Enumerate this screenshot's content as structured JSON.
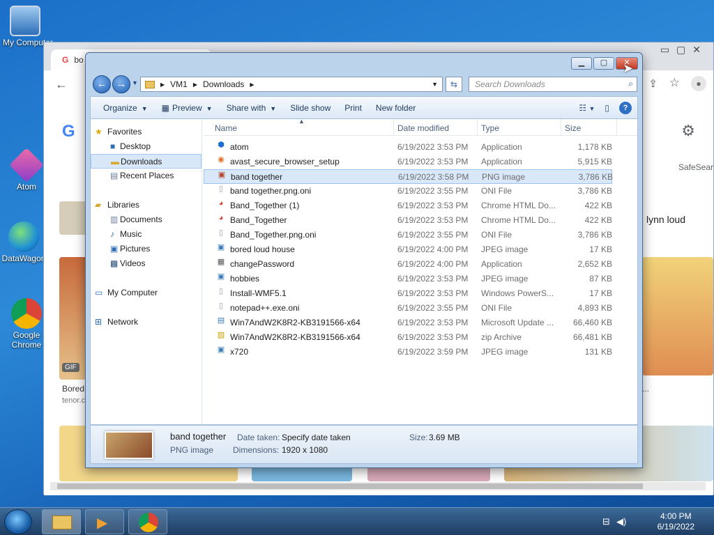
{
  "desktop": {
    "icons": [
      {
        "label": "My Computer",
        "icon": "computer-icon"
      },
      {
        "label": "Atom",
        "icon": "atom-icon"
      },
      {
        "label": "DataWagon",
        "icon": "globe-icon"
      },
      {
        "label": "Google Chrome",
        "icon": "chrome-icon"
      }
    ]
  },
  "chrome": {
    "tab_title": "bo",
    "lynn_text": "lynn loud",
    "safesearch": "SafeSear",
    "gif_badge": "GIF",
    "bored_caption": "Bored",
    "tenor": "tenor.c",
    "ellipsis": "..."
  },
  "explorer": {
    "breadcrumb": [
      "VM1",
      "Downloads"
    ],
    "search_placeholder": "Search Downloads",
    "toolbar": {
      "organize": "Organize",
      "preview": "Preview",
      "share_with": "Share with",
      "slide_show": "Slide show",
      "print": "Print",
      "new_folder": "New folder"
    },
    "nav": {
      "favorites": "Favorites",
      "desktop": "Desktop",
      "downloads": "Downloads",
      "recent_places": "Recent Places",
      "libraries": "Libraries",
      "documents": "Documents",
      "music": "Music",
      "pictures": "Pictures",
      "videos": "Videos",
      "my_computer": "My Computer",
      "network": "Network"
    },
    "columns": {
      "name": "Name",
      "date": "Date modified",
      "type": "Type",
      "size": "Size"
    },
    "files": [
      {
        "name": "atom",
        "date": "6/19/2022 3:53 PM",
        "type": "Application",
        "size": "1,178 KB",
        "icon": "atom-app-icon"
      },
      {
        "name": "avast_secure_browser_setup",
        "date": "6/19/2022 3:53 PM",
        "type": "Application",
        "size": "5,915 KB",
        "icon": "avast-app-icon"
      },
      {
        "name": "band together",
        "date": "6/19/2022 3:58 PM",
        "type": "PNG image",
        "size": "3,786 KB",
        "icon": "png-image-icon"
      },
      {
        "name": "band together.png.oni",
        "date": "6/19/2022 3:55 PM",
        "type": "ONI File",
        "size": "3,786 KB",
        "icon": "blank-file-icon"
      },
      {
        "name": "Band_Together (1)",
        "date": "6/19/2022 3:53 PM",
        "type": "Chrome HTML Do...",
        "size": "422 KB",
        "icon": "chrome-html-icon"
      },
      {
        "name": "Band_Together",
        "date": "6/19/2022 3:53 PM",
        "type": "Chrome HTML Do...",
        "size": "422 KB",
        "icon": "chrome-html-icon"
      },
      {
        "name": "Band_Together.png.oni",
        "date": "6/19/2022 3:55 PM",
        "type": "ONI File",
        "size": "3,786 KB",
        "icon": "blank-file-icon"
      },
      {
        "name": "bored loud house",
        "date": "6/19/2022 4:00 PM",
        "type": "JPEG image",
        "size": "17 KB",
        "icon": "jpeg-image-icon"
      },
      {
        "name": "changePassword",
        "date": "6/19/2022 4:00 PM",
        "type": "Application",
        "size": "2,652 KB",
        "icon": "app-icon"
      },
      {
        "name": "hobbies",
        "date": "6/19/2022 3:53 PM",
        "type": "JPEG image",
        "size": "87 KB",
        "icon": "jpeg-image-icon"
      },
      {
        "name": "Install-WMF5.1",
        "date": "6/19/2022 3:53 PM",
        "type": "Windows PowerS...",
        "size": "17 KB",
        "icon": "powershell-file-icon"
      },
      {
        "name": "notepad++.exe.oni",
        "date": "6/19/2022 3:55 PM",
        "type": "ONI File",
        "size": "4,893 KB",
        "icon": "blank-file-icon"
      },
      {
        "name": "Win7AndW2K8R2-KB3191566-x64",
        "date": "6/19/2022 3:53 PM",
        "type": "Microsoft Update ...",
        "size": "66,460 KB",
        "icon": "update-file-icon"
      },
      {
        "name": "Win7AndW2K8R2-KB3191566-x64",
        "date": "6/19/2022 3:53 PM",
        "type": "zip Archive",
        "size": "66,481 KB",
        "icon": "zip-file-icon"
      },
      {
        "name": "x720",
        "date": "6/19/2022 3:59 PM",
        "type": "JPEG image",
        "size": "131 KB",
        "icon": "jpeg-image-icon"
      }
    ],
    "details": {
      "name": "band together",
      "type": "PNG image",
      "date_taken_label": "Date taken:",
      "date_taken_value": "Specify date taken",
      "dimensions_label": "Dimensions:",
      "dimensions_value": "1920 x 1080",
      "size_label": "Size:",
      "size_value": "3.69 MB"
    }
  },
  "taskbar": {
    "time": "4:00 PM",
    "date": "6/19/2022"
  }
}
